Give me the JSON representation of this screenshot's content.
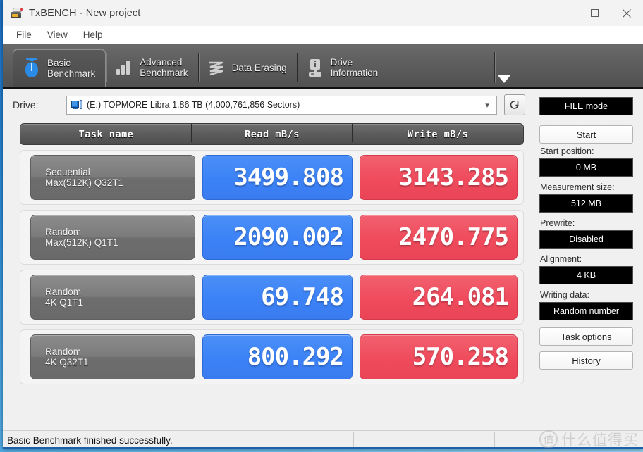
{
  "window": {
    "title": "TxBENCH - New project",
    "app_icon": "drive-icon",
    "minimize_label": "–",
    "maximize_label": "□",
    "close_label": "✕"
  },
  "menubar": [
    {
      "label": "File"
    },
    {
      "label": "View"
    },
    {
      "label": "Help"
    }
  ],
  "tabs": [
    {
      "label_line1": "Basic",
      "label_line2": "Benchmark",
      "icon": "stopwatch-icon",
      "active": true
    },
    {
      "label_line1": "Advanced",
      "label_line2": "Benchmark",
      "icon": "bar-chart-icon",
      "active": false
    },
    {
      "label_line1": "Data Erasing",
      "label_line2": "",
      "icon": "zigzag-erase-icon",
      "active": false
    },
    {
      "label_line1": "Drive",
      "label_line2": "Information",
      "icon": "drive-info-icon",
      "active": false
    }
  ],
  "tab_overflow": {
    "icon": "chevron-down-icon"
  },
  "drive": {
    "label": "Drive:",
    "selected": "(E:) TOPMORE Libra  1.86 TB (4,000,761,856 Sectors)",
    "dropdown_icon": "chevron-down-icon",
    "refresh_icon": "refresh-icon"
  },
  "table": {
    "headers": [
      "Task name",
      "Read mB/s",
      "Write mB/s"
    ],
    "rows": [
      {
        "task_line1": "Sequential",
        "task_line2": "Max(512K) Q32T1",
        "read": "3499.808",
        "write": "3143.285"
      },
      {
        "task_line1": "Random",
        "task_line2": "Max(512K) Q1T1",
        "read": "2090.002",
        "write": "2470.775"
      },
      {
        "task_line1": "Random",
        "task_line2": "4K Q1T1",
        "read": "69.748",
        "write": "264.081"
      },
      {
        "task_line1": "Random",
        "task_line2": "4K Q32T1",
        "read": "800.292",
        "write": "570.258"
      }
    ]
  },
  "sidebar": {
    "mode_button": "FILE mode",
    "start_button": "Start",
    "start_position_label": "Start position:",
    "start_position_value": "0 MB",
    "measurement_size_label": "Measurement size:",
    "measurement_size_value": "512 MB",
    "prewrite_label": "Prewrite:",
    "prewrite_value": "Disabled",
    "alignment_label": "Alignment:",
    "alignment_value": "4 KB",
    "writing_data_label": "Writing data:",
    "writing_data_value": "Random number",
    "task_options_button": "Task options",
    "history_button": "History"
  },
  "statusbar": {
    "message": "Basic Benchmark finished successfully."
  },
  "watermark": {
    "logo_text": "值",
    "text": "什么值得买"
  },
  "colors": {
    "read_accent": "#3b82f6",
    "write_accent": "#ef4b5c",
    "tab_strip": "#5e5e5e",
    "desktop": "#2d8ed8"
  }
}
